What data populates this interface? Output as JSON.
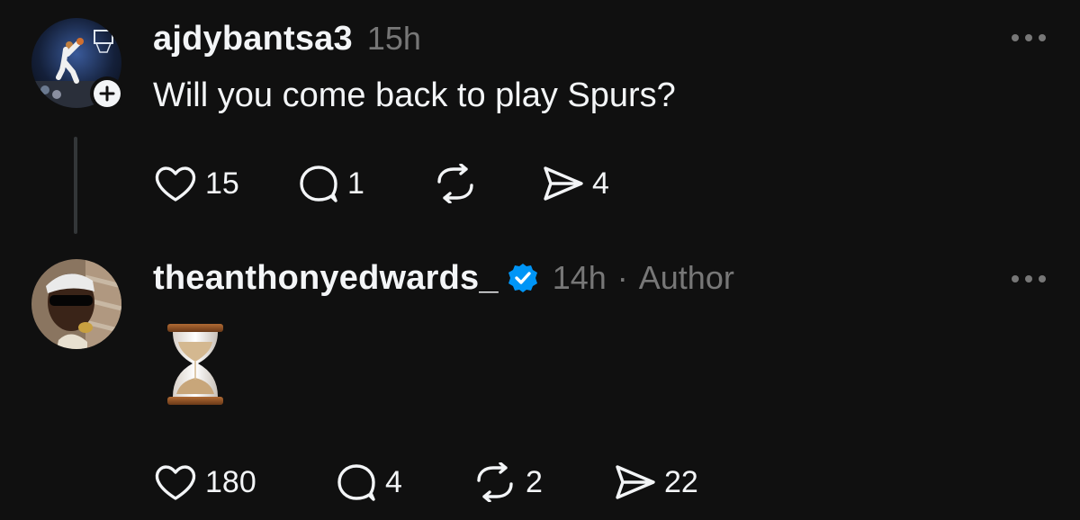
{
  "posts": [
    {
      "username": "ajdybantsa3",
      "time": "15h",
      "text": "Will you come back to play Spurs?",
      "avatar": "basketball-dunk-photo",
      "has_follow_button": true,
      "actions": {
        "likes": "15",
        "replies": "1",
        "reposts": "",
        "shares": "4"
      }
    },
    {
      "username": "theanthonyedwards_",
      "verified": true,
      "time": "14h",
      "separator": "·",
      "author_label": "Author",
      "content_emoji": "hourglass-emoji",
      "avatar": "profile-photo-sunglasses",
      "actions": {
        "likes": "180",
        "replies": "4",
        "reposts": "2",
        "shares": "22"
      }
    }
  ],
  "colors": {
    "background": "#101010",
    "text": "#f3f5f7",
    "muted": "#777777",
    "verified": "#0095f6",
    "thread_line": "#333638"
  },
  "icons": [
    "heart-icon",
    "reply-icon",
    "repost-icon",
    "share-icon",
    "more-icon",
    "verified-icon",
    "plus-icon"
  ]
}
